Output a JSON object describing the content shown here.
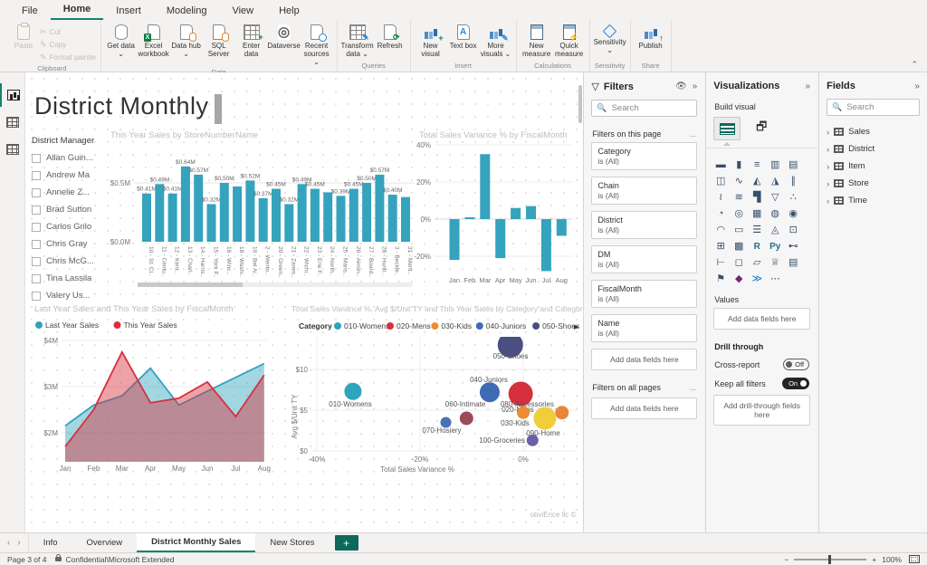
{
  "ribbon": {
    "tabs": [
      {
        "label": "File",
        "active": false
      },
      {
        "label": "Home",
        "active": true
      },
      {
        "label": "Insert",
        "active": false
      },
      {
        "label": "Modeling",
        "active": false
      },
      {
        "label": "View",
        "active": false
      },
      {
        "label": "Help",
        "active": false
      }
    ],
    "groups": [
      {
        "label": "Clipboard",
        "big": [
          {
            "label": "Paste",
            "icon": "paste-icon",
            "disabled": true
          }
        ],
        "small": [
          {
            "label": "Cut",
            "icon": "cut-icon"
          },
          {
            "label": "Copy",
            "icon": "copy-icon"
          },
          {
            "label": "Format painter",
            "icon": "format-painter-icon"
          }
        ]
      },
      {
        "label": "Data",
        "big": [
          {
            "label": "Get data",
            "icon": "get-data-icon",
            "arrow": true
          },
          {
            "label": "Excel workbook",
            "icon": "excel-workbook-icon"
          },
          {
            "label": "Data hub",
            "icon": "data-hub-icon",
            "arrow": true
          },
          {
            "label": "SQL Server",
            "icon": "sql-server-icon"
          },
          {
            "label": "Enter data",
            "icon": "enter-data-icon"
          },
          {
            "label": "Dataverse",
            "icon": "dataverse-icon"
          },
          {
            "label": "Recent sources",
            "icon": "recent-sources-icon",
            "arrow": true
          }
        ],
        "small": []
      },
      {
        "label": "Queries",
        "big": [
          {
            "label": "Transform data",
            "icon": "transform-data-icon",
            "arrow": true
          },
          {
            "label": "Refresh",
            "icon": "refresh-icon"
          }
        ],
        "small": []
      },
      {
        "label": "Insert",
        "big": [
          {
            "label": "New visual",
            "icon": "new-visual-icon"
          },
          {
            "label": "Text box",
            "icon": "text-box-icon"
          },
          {
            "label": "More visuals",
            "icon": "more-visuals-icon",
            "arrow": true
          }
        ],
        "small": []
      },
      {
        "label": "Calculations",
        "big": [
          {
            "label": "New measure",
            "icon": "new-measure-icon"
          },
          {
            "label": "Quick measure",
            "icon": "quick-measure-icon"
          }
        ],
        "small": []
      },
      {
        "label": "Sensitivity",
        "big": [
          {
            "label": "Sensitivity",
            "icon": "sensitivity-icon",
            "arrow": true
          }
        ],
        "small": []
      },
      {
        "label": "Share",
        "big": [
          {
            "label": "Publish",
            "icon": "publish-icon"
          }
        ],
        "small": []
      }
    ]
  },
  "rail": [
    {
      "name": "report-view-icon",
      "selected": true
    },
    {
      "name": "data-view-icon",
      "selected": false
    },
    {
      "name": "model-view-icon",
      "selected": false
    }
  ],
  "canvas": {
    "title": "District Monthly",
    "slicer": {
      "title": "District Manager",
      "items": [
        "Allan Guin...",
        "Andrew Ma",
        "Annelie Z...",
        "Brad Sutton",
        "Carlos Grilo",
        "Chris Gray",
        "Chris McG...",
        "Tina Lassila",
        "Valery Us..."
      ]
    },
    "credit": "obviEnce llc ©"
  },
  "chart_data": [
    {
      "type": "bar",
      "title": "This Year Sales by StoreNumberName",
      "categories": [
        "10 - St. Cl..",
        "11 - Centu..",
        "12 - Kent..",
        "13 - Charl..",
        "14 - Harris..",
        "15 - York F..",
        "16 - Winc..",
        "18 - Washi..",
        "19 - Bel Ai..",
        "2 - Weirto..",
        "20 - Green..",
        "21 - Zanes..",
        "22 - Wichi..",
        "23 - Erie F..",
        "24 - North..",
        "25 - Mans..",
        "26 - Akron..",
        "27 - Board..",
        "28 - Hunti..",
        "3 - Beckle..",
        "31 - Ment.."
      ],
      "values": [
        0.41,
        0.49,
        0.41,
        0.64,
        0.57,
        0.32,
        0.5,
        0.47,
        0.52,
        0.37,
        0.45,
        0.32,
        0.49,
        0.45,
        0.42,
        0.39,
        0.45,
        0.5,
        0.57,
        0.4,
        0.38
      ],
      "labels": [
        "$0.41M",
        "$0.49M",
        "$0.41M",
        "$0.64M",
        "$0.57M",
        "$0.32M",
        "$0.50M",
        "",
        "$0.52M",
        "$0.37M",
        "$0.45M",
        "$0.32M",
        "$0.49M",
        "$0.45M",
        "",
        "$0.39M",
        "$0.45M",
        "$0.50M",
        "$0.57M",
        "$0.40M",
        ""
      ],
      "yticks": [
        {
          "label": "$0.5M",
          "v": 0.5
        },
        {
          "label": "$0.0M",
          "v": 0
        }
      ],
      "ylim": [
        0,
        0.8
      ],
      "color": "#35a3bd",
      "has_scrollbar": true
    },
    {
      "type": "column",
      "title": "Total Sales Variance % by FiscalMonth",
      "categories": [
        "Jan",
        "Feb",
        "Mar",
        "Apr",
        "May",
        "Jun",
        "Jul",
        "Aug"
      ],
      "values": [
        -22,
        1,
        35,
        -21,
        6,
        7,
        -28,
        -9
      ],
      "yticks": [
        {
          "label": "40%",
          "v": 40
        },
        {
          "label": "20%",
          "v": 20
        },
        {
          "label": "0%",
          "v": 0
        },
        {
          "label": "-20%",
          "v": -20
        }
      ],
      "ylim": [
        -32,
        44
      ],
      "color": "#35a3bd"
    },
    {
      "type": "area",
      "title": "Last Year Sales and This Year Sales by FiscalMonth",
      "categories": [
        "Jan",
        "Feb",
        "Mar",
        "Apr",
        "May",
        "Jun",
        "Jul",
        "Aug"
      ],
      "series": [
        {
          "name": "Last Year Sales",
          "color": "#31a3bc",
          "values": [
            2.15,
            2.6,
            2.8,
            3.4,
            2.6,
            2.9,
            3.2,
            3.5
          ]
        },
        {
          "name": "This Year Sales",
          "color": "#d6303c",
          "values": [
            1.7,
            2.5,
            3.75,
            2.65,
            2.75,
            3.1,
            2.35,
            3.25
          ]
        }
      ],
      "yticks": [
        {
          "label": "$4M",
          "v": 4
        },
        {
          "label": "$3M",
          "v": 3
        },
        {
          "label": "$2M",
          "v": 2
        }
      ],
      "ylim": [
        1.5,
        4.2
      ],
      "legend_position": "top"
    },
    {
      "type": "scatter",
      "title": "Total Sales Variance %, Avg $/Unit TY and This Year Sales by Category and Category",
      "xlabel": "Total Sales Variance %",
      "ylabel": "Avg $/Unit TY",
      "legend_title": "Category",
      "legend": [
        {
          "name": "010-Womens",
          "color": "#2ca5bd"
        },
        {
          "name": "020-Mens",
          "color": "#d6303c"
        },
        {
          "name": "030-Kids",
          "color": "#ef8a33"
        },
        {
          "name": "040-Juniors",
          "color": "#3f6bb5"
        },
        {
          "name": "050-Shoes",
          "color": "#4a4f80"
        }
      ],
      "points": [
        {
          "name": "010-Womens",
          "x": -33,
          "y": 7.3,
          "r": 9.5,
          "color": "#2ca5bd",
          "lx": 359,
          "ly": 369,
          "anchor": "middle"
        },
        {
          "name": "070-Hosiery",
          "x": -15,
          "y": 3.5,
          "r": 6,
          "color": "#4a72b2",
          "lx": 460,
          "ly": 398,
          "anchor": "middle"
        },
        {
          "name": "060-Intimate",
          "x": -11,
          "y": 4.0,
          "r": 7.5,
          "color": "#9a4b57",
          "lx": 486,
          "ly": 369,
          "anchor": "middle"
        },
        {
          "name": "040-Juniors",
          "x": -6.5,
          "y": 7.2,
          "r": 11,
          "color": "#3f6bb5",
          "lx": 512,
          "ly": 342,
          "anchor": "middle"
        },
        {
          "name": "050-Shoes",
          "x": -2.5,
          "y": 13,
          "r": 14,
          "color": "#4a4f80",
          "lx": 536,
          "ly": 316,
          "anchor": "middle",
          "clip": true
        },
        {
          "name": "020-Mens",
          "x": -0.5,
          "y": 7.0,
          "r": 13.5,
          "color": "#d6303c",
          "lx": 544,
          "ly": 375,
          "anchor": "middle"
        },
        {
          "name": "030-Kids",
          "x": 0,
          "y": 4.7,
          "r": 7,
          "color": "#ef8a33",
          "lx": 541,
          "ly": 390,
          "anchor": "middle"
        },
        {
          "name": "080-Accessories",
          "x": 7.5,
          "y": 4.7,
          "r": 7.5,
          "color": "#e8873b",
          "lx": 584,
          "ly": 369,
          "anchor": "end",
          "leader": true
        },
        {
          "name": "090-Home",
          "x": 4.2,
          "y": 4.0,
          "r": 12.5,
          "color": "#efce3a",
          "lx": 572,
          "ly": 401,
          "anchor": "middle"
        },
        {
          "name": "100-Groceries",
          "x": 1.8,
          "y": 1.3,
          "r": 6.5,
          "color": "#6c5fa7",
          "lx": 552,
          "ly": 409,
          "anchor": "end"
        }
      ],
      "xticks": [
        {
          "label": "-40%",
          "v": -40
        },
        {
          "label": "-20%",
          "v": -20
        },
        {
          "label": "0%",
          "v": 0
        }
      ],
      "yticks": [
        {
          "label": "$10",
          "v": 10
        },
        {
          "label": "$5",
          "v": 5
        },
        {
          "label": "$0",
          "v": 0
        }
      ],
      "legend_more_arrow": "▶"
    }
  ],
  "filters_pane": {
    "title": "Filters",
    "search_placeholder": "Search",
    "eye_icon": "visibility-icon",
    "collapse_icon": "»",
    "section_page": "Filters on this page",
    "section_all": "Filters on all pages",
    "ellipsis": "...",
    "cards": [
      {
        "name": "Category",
        "value": "is (All)"
      },
      {
        "name": "Chain",
        "value": "is (All)"
      },
      {
        "name": "District",
        "value": "is (All)"
      },
      {
        "name": "DM",
        "value": "is (All)"
      },
      {
        "name": "FiscalMonth",
        "value": "is (All)"
      },
      {
        "name": "Name",
        "value": "is (All)"
      }
    ],
    "add_fields": "Add data fields here"
  },
  "viz_pane": {
    "title": "Visualizations",
    "collapse_icon": "»",
    "build_label": "Build visual",
    "icons": [
      {
        "name": "stacked-bar-chart-icon",
        "glyph": "▬"
      },
      {
        "name": "stacked-column-chart-icon",
        "glyph": "▮"
      },
      {
        "name": "clustered-bar-chart-icon",
        "glyph": "≡"
      },
      {
        "name": "clustered-column-chart-icon",
        "glyph": "▥"
      },
      {
        "name": "hundred-stacked-bar-chart-icon",
        "glyph": "▤"
      },
      {
        "name": "hundred-stacked-column-chart-icon",
        "glyph": "◫"
      },
      {
        "name": "line-chart-icon",
        "glyph": "∿"
      },
      {
        "name": "area-chart-icon",
        "glyph": "◭"
      },
      {
        "name": "stacked-area-chart-icon",
        "glyph": "◮"
      },
      {
        "name": "line-stacked-column-chart-icon",
        "glyph": "∥"
      },
      {
        "name": "line-clustered-column-chart-icon",
        "glyph": "≀"
      },
      {
        "name": "ribbon-chart-icon",
        "glyph": "≋"
      },
      {
        "name": "waterfall-chart-icon",
        "glyph": "▜"
      },
      {
        "name": "funnel-chart-icon",
        "glyph": "▽"
      },
      {
        "name": "scatter-chart-icon",
        "glyph": "∴"
      },
      {
        "name": "pie-chart-icon",
        "glyph": "◔"
      },
      {
        "name": "donut-chart-icon",
        "glyph": "◎"
      },
      {
        "name": "treemap-icon",
        "glyph": "▦"
      },
      {
        "name": "map-icon",
        "glyph": "◍"
      },
      {
        "name": "filled-map-icon",
        "glyph": "◉"
      },
      {
        "name": "gauge-icon",
        "glyph": "◠"
      },
      {
        "name": "card-icon",
        "glyph": "▭"
      },
      {
        "name": "multi-row-card-icon",
        "glyph": "☰"
      },
      {
        "name": "kpi-icon",
        "glyph": "◬"
      },
      {
        "name": "slicer-icon",
        "glyph": "⊡"
      },
      {
        "name": "table-icon",
        "glyph": "⊞"
      },
      {
        "name": "matrix-icon",
        "glyph": "▩"
      },
      {
        "name": "r-script-icon",
        "glyph": "R"
      },
      {
        "name": "python-icon",
        "glyph": "Py"
      },
      {
        "name": "key-influencers-icon",
        "glyph": "⊷"
      },
      {
        "name": "decomposition-tree-icon",
        "glyph": "⊢"
      },
      {
        "name": "qa-icon",
        "glyph": "◻"
      },
      {
        "name": "smart-narrative-icon",
        "glyph": "▱"
      },
      {
        "name": "metrics-icon",
        "glyph": "♕"
      },
      {
        "name": "paginated-report-icon",
        "glyph": "▤"
      },
      {
        "name": "arcgis-map-icon",
        "glyph": "⚑"
      },
      {
        "name": "power-apps-icon",
        "glyph": "◆",
        "color": "#742774"
      },
      {
        "name": "power-automate-icon",
        "glyph": "≫",
        "color": "#0078d4"
      },
      {
        "name": "more-visuals-icon",
        "glyph": "⋯"
      }
    ],
    "values_label": "Values",
    "values_add": "Add data fields here",
    "drill_label": "Drill through",
    "toggles": [
      {
        "label": "Cross-report",
        "state": "Off",
        "on": false
      },
      {
        "label": "Keep all filters",
        "state": "On",
        "on": true
      }
    ],
    "drill_add": "Add drill-through fields here"
  },
  "fields_pane": {
    "title": "Fields",
    "collapse_icon": "»",
    "search_placeholder": "Search",
    "items": [
      {
        "label": "Sales"
      },
      {
        "label": "District"
      },
      {
        "label": "Item"
      },
      {
        "label": "Store"
      },
      {
        "label": "Time"
      }
    ]
  },
  "tabbar": {
    "tabs": [
      {
        "label": "Info",
        "active": false
      },
      {
        "label": "Overview",
        "active": false
      },
      {
        "label": "District Monthly Sales",
        "active": true
      },
      {
        "label": "New Stores",
        "active": false
      }
    ],
    "add_page": "+"
  },
  "statusbar": {
    "page_indicator": "Page 3 of 4",
    "sensitivity_label": "Confidential\\Microsoft Extended",
    "zoom_level": "100%"
  },
  "colors": {
    "accent_teal": "#35a3bd",
    "accent_red": "#d6303c",
    "brand_green": "#0c695c",
    "tab_underline": "#12836c"
  }
}
